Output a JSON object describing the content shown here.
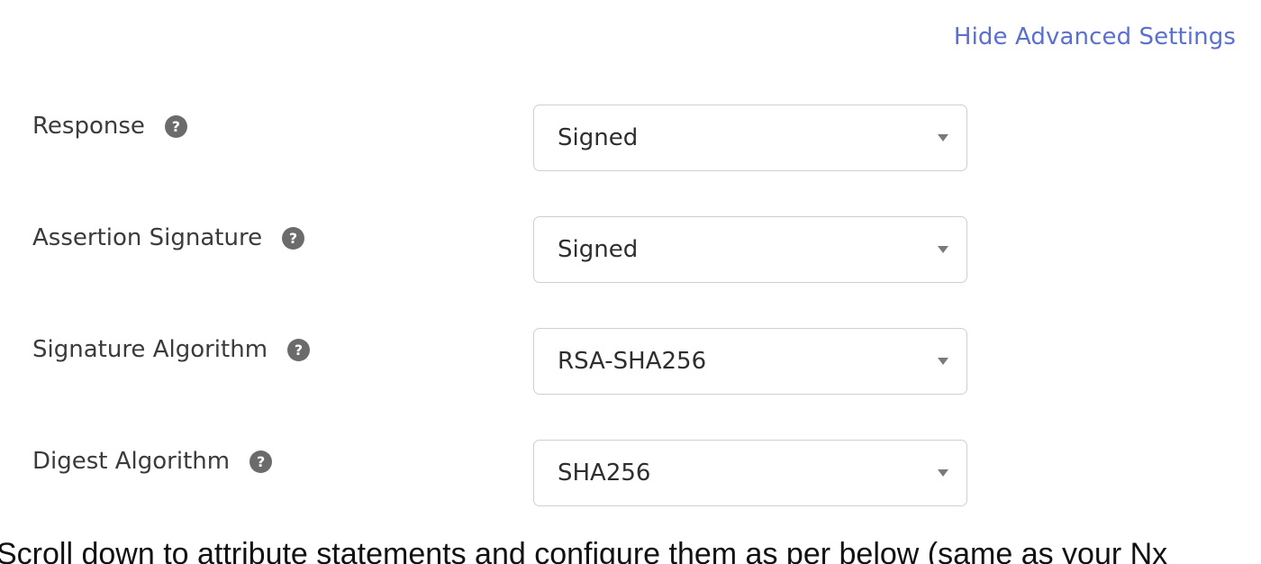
{
  "advanced": {
    "toggle_label": "Hide Advanced Settings"
  },
  "help_icon_glyph": "?",
  "fields": [
    {
      "label": "Response",
      "value": "Signed"
    },
    {
      "label": "Assertion Signature",
      "value": "Signed"
    },
    {
      "label": "Signature Algorithm",
      "value": "RSA-SHA256"
    },
    {
      "label": "Digest Algorithm",
      "value": "SHA256"
    }
  ],
  "instruction": "Scroll down to attribute statements and configure them as per below (same as your Nx",
  "colors": {
    "link": "#5a6fcf",
    "border": "#cfcfcf",
    "help_icon": "#6b6b6b"
  }
}
